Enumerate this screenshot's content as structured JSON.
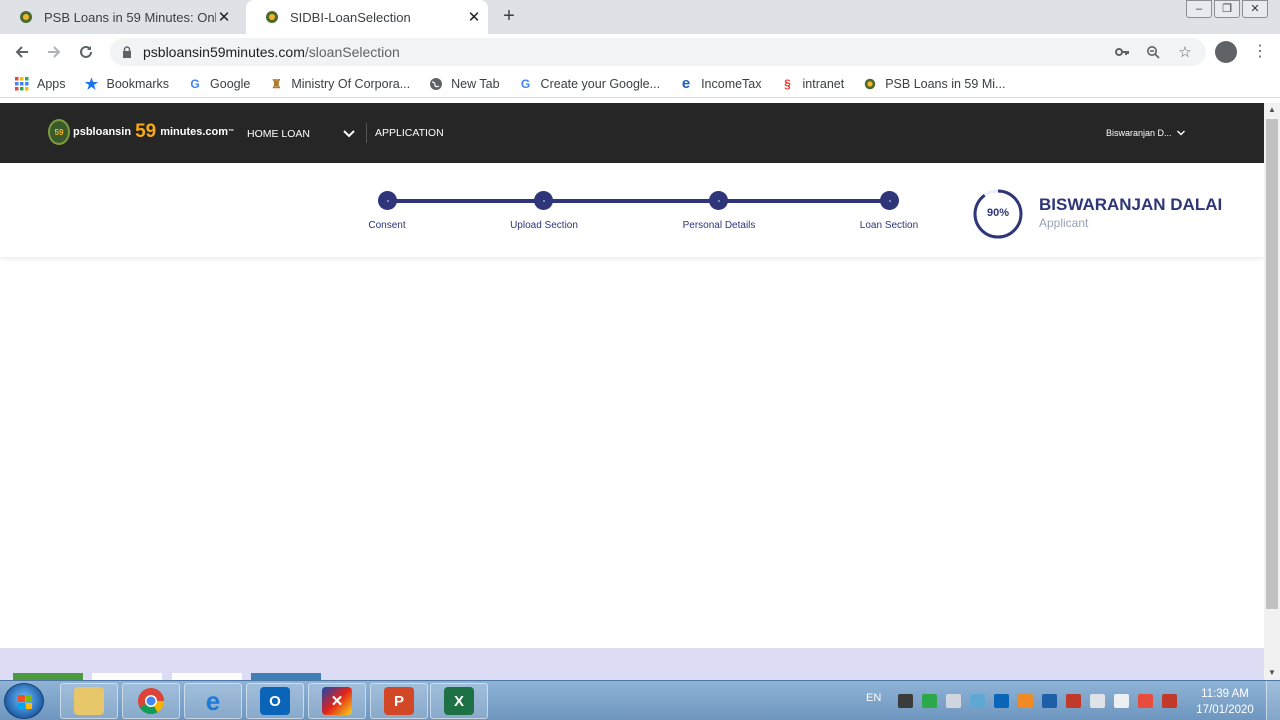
{
  "browser": {
    "tabs": [
      {
        "title": "PSB Loans in 59 Minutes: Online"
      },
      {
        "title": "SIDBI-LoanSelection"
      }
    ],
    "url_host": "psbloansin59minutes.com",
    "url_path": "/sloanSelection",
    "bookmarks": [
      "Apps",
      "Bookmarks",
      "Google",
      "Ministry Of Corpora...",
      "New Tab",
      "Create your Google...",
      "IncomeTax",
      "intranet",
      "PSB Loans in 59 Mi..."
    ]
  },
  "site": {
    "logo": {
      "prefix": "psbloansin",
      "number": "59",
      "suffix": "minutes.com",
      "tm": "™",
      "seal": "59"
    },
    "nav": {
      "home_loan": "HOME LOAN",
      "application": "APPLICATION",
      "user": "Biswaranjan D..."
    },
    "steps": [
      {
        "label": "Consent"
      },
      {
        "label": "Upload Section"
      },
      {
        "label": "Personal Details"
      },
      {
        "label": "Loan Section"
      }
    ],
    "progress": {
      "percent": 90,
      "text": "90%"
    },
    "applicant": {
      "name": "BISWARANJAN DALAI",
      "role": "Applicant"
    }
  },
  "taskbar": {
    "lang": "EN",
    "time": "11:39 AM",
    "date": "17/01/2020"
  },
  "colors": {
    "brand": "#2e3578",
    "nav_bg": "#262626",
    "logo_accent": "#f7a81b"
  }
}
